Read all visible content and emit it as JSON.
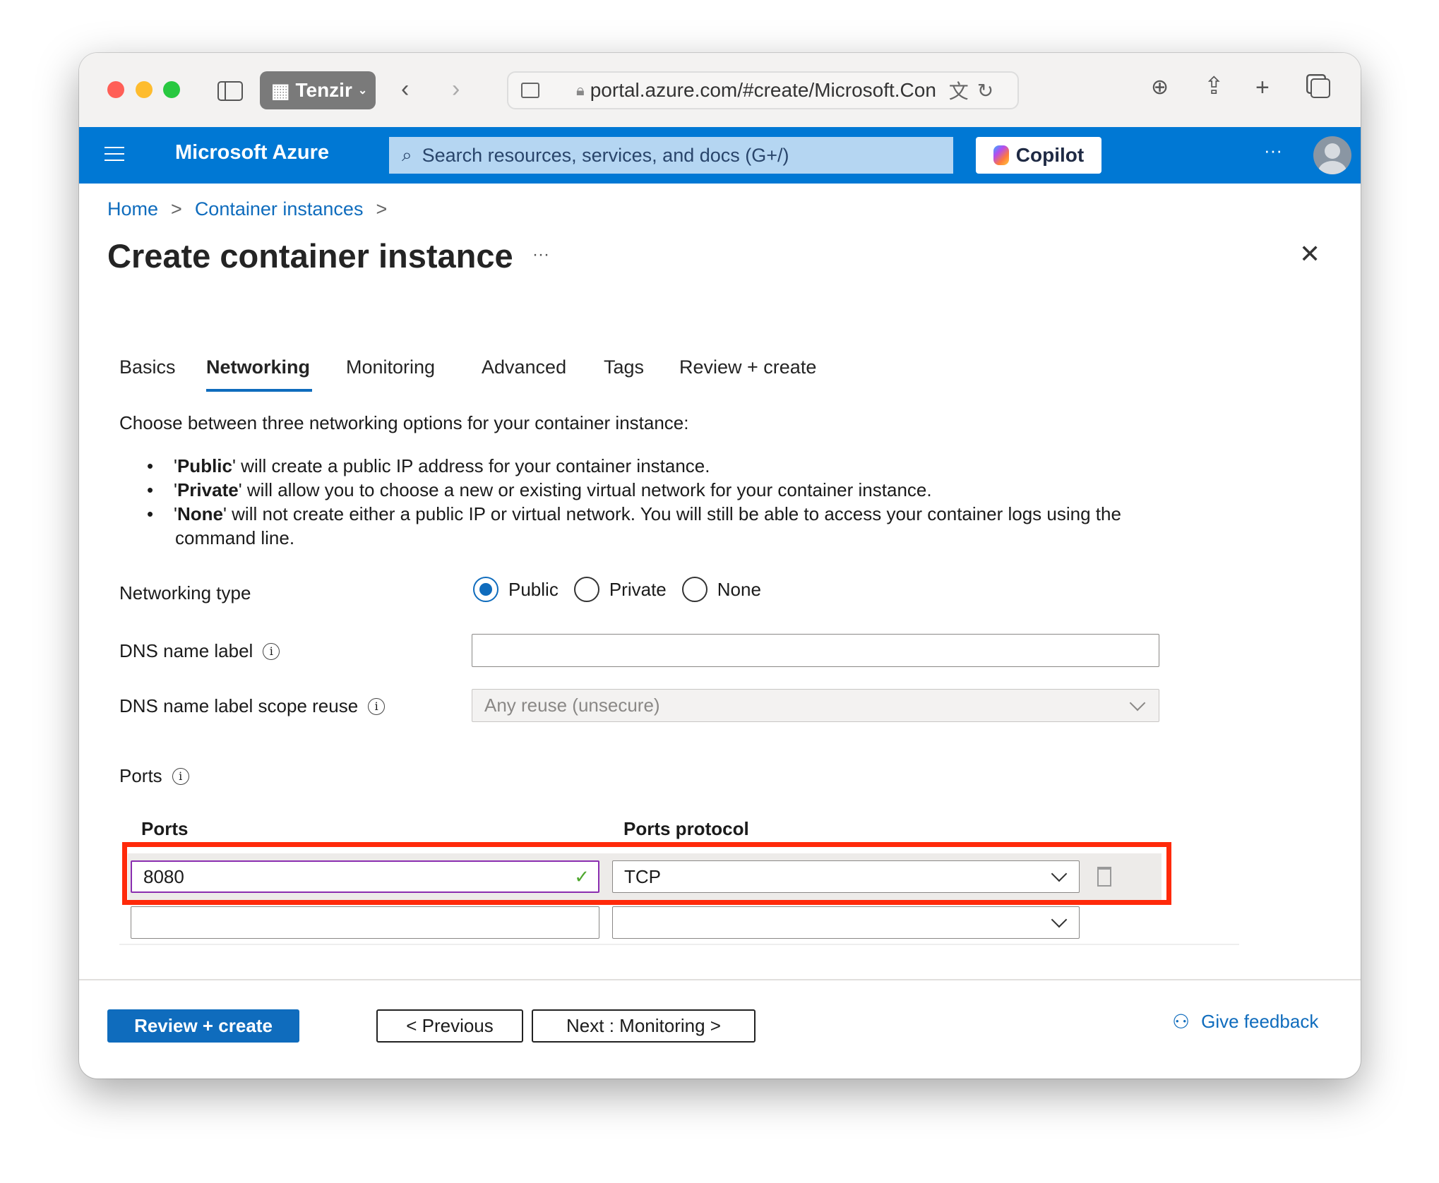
{
  "browser": {
    "profile": "Tenzir",
    "url": "portal.azure.com/#create/Microsoft.Con",
    "lights": [
      "#ff5f57",
      "#febc2e",
      "#28c840"
    ]
  },
  "azure": {
    "brand": "Microsoft Azure",
    "search_placeholder": "Search resources, services, and docs (G+/)",
    "copilot": "Copilot",
    "more": "···",
    "accent": "#0078d4"
  },
  "breadcrumb": {
    "home": "Home",
    "container_instances": "Container instances",
    "sep": ">"
  },
  "page": {
    "title": "Create container instance",
    "more": "···"
  },
  "tabs": [
    {
      "label": "Basics"
    },
    {
      "label": "Networking",
      "active": true
    },
    {
      "label": "Monitoring"
    },
    {
      "label": "Advanced"
    },
    {
      "label": "Tags"
    },
    {
      "label": "Review + create"
    }
  ],
  "description": {
    "intro": "Choose between three networking options for your container instance:",
    "bullets": [
      {
        "bold": "Public",
        "rest": "' will create a public IP address for your container instance."
      },
      {
        "bold": "Private",
        "rest": "' will allow you to choose a new or existing virtual network for your container instance."
      },
      {
        "bold": "None",
        "rest": "' will not create either a public IP or virtual network. You will still be able to access your container logs using the"
      },
      {
        "bold": "",
        "rest": "command line."
      }
    ]
  },
  "form": {
    "networking_type": {
      "label": "Networking type",
      "options": [
        "Public",
        "Private",
        "None"
      ],
      "selected": "Public"
    },
    "dns_label": {
      "label": "DNS name label",
      "value": ""
    },
    "dns_scope": {
      "label": "DNS name label scope reuse",
      "value": "Any reuse (unsecure)"
    },
    "ports_label": "Ports",
    "ports_table": {
      "col_ports": "Ports",
      "col_protocol": "Ports protocol",
      "rows": [
        {
          "port": "8080",
          "protocol": "TCP",
          "valid": true
        },
        {
          "port": "",
          "protocol": ""
        }
      ]
    }
  },
  "footer": {
    "review_create": "Review + create",
    "previous": "< Previous",
    "next": "Next : Monitoring >",
    "feedback": "Give feedback"
  }
}
